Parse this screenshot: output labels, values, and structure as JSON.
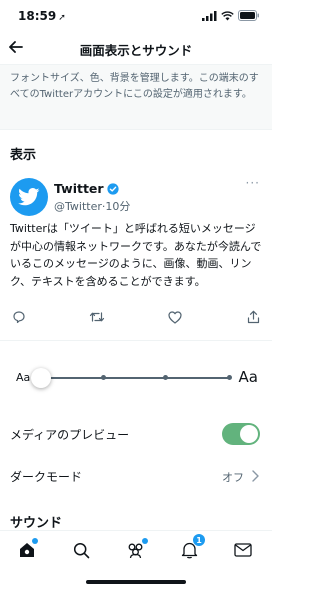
{
  "status": {
    "time": "18:59",
    "location_glyph": "➚"
  },
  "nav": {
    "title": "画面表示とサウンド"
  },
  "description": "フォントサイズ、色、背景を管理します。この端末のすべてのTwitterアカウントにこの設定が適用されます。",
  "display": {
    "heading": "表示"
  },
  "tweet": {
    "name": "Twitter",
    "handle_time": "@Twitter·10分",
    "body": "Twitterは「ツイート」と呼ばれる短いメッセージが中心の情報ネットワークです。あなたが今読んでいるこのメッセージのように、画像、動画、リンク、テキストを含めることができます。",
    "more_glyph": "···"
  },
  "font_size": {
    "small_label": "Aa",
    "large_label": "Aa",
    "level_fraction": 0.0,
    "step_count": 5
  },
  "media_preview": {
    "label": "メディアのプレビュー",
    "enabled": true
  },
  "dark_mode": {
    "label": "ダークモード",
    "value": "オフ"
  },
  "sound": {
    "heading": "サウンド"
  },
  "tabbar": {
    "notifications_badge": "1"
  },
  "colors": {
    "accent": "#1d9bf0",
    "toggle_on": "#62b37d",
    "secondary_text": "#536471"
  }
}
